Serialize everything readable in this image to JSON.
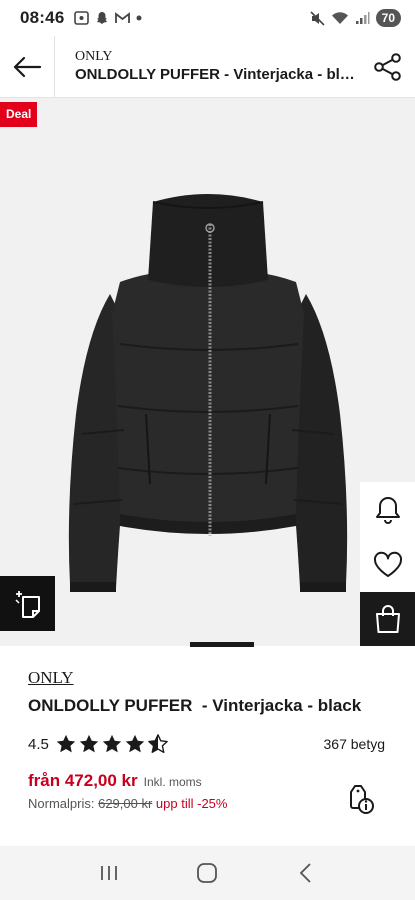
{
  "status": {
    "time": "08:46",
    "battery": "70"
  },
  "header": {
    "brand": "ONLY",
    "title": "ONLDOLLY PUFFER  - Vinterjacka - bla..."
  },
  "image": {
    "deal_badge": "Deal"
  },
  "product": {
    "brand": "ONLY",
    "name": "ONLDOLLY PUFFER",
    "description": "- Vinterjacka - black",
    "rating": "4.5",
    "stars_filled": 4.5,
    "review_count": "367 betyg",
    "price": "från 472,00 kr",
    "tax_note": "Inkl. moms",
    "normal_label": "Normalpris:",
    "normal_price": "629,00 kr",
    "discount": "upp till -25%"
  },
  "colors": {
    "accent_red": "#c8001f",
    "deal_red": "#e3001b",
    "dark": "#1a1a1a"
  },
  "icons": {
    "back": "arrow-left-icon",
    "share": "share-icon",
    "bell": "bell-icon",
    "heart": "heart-icon",
    "bag": "shopping-bag-icon",
    "similar": "similar-items-icon",
    "info": "price-info-icon"
  }
}
